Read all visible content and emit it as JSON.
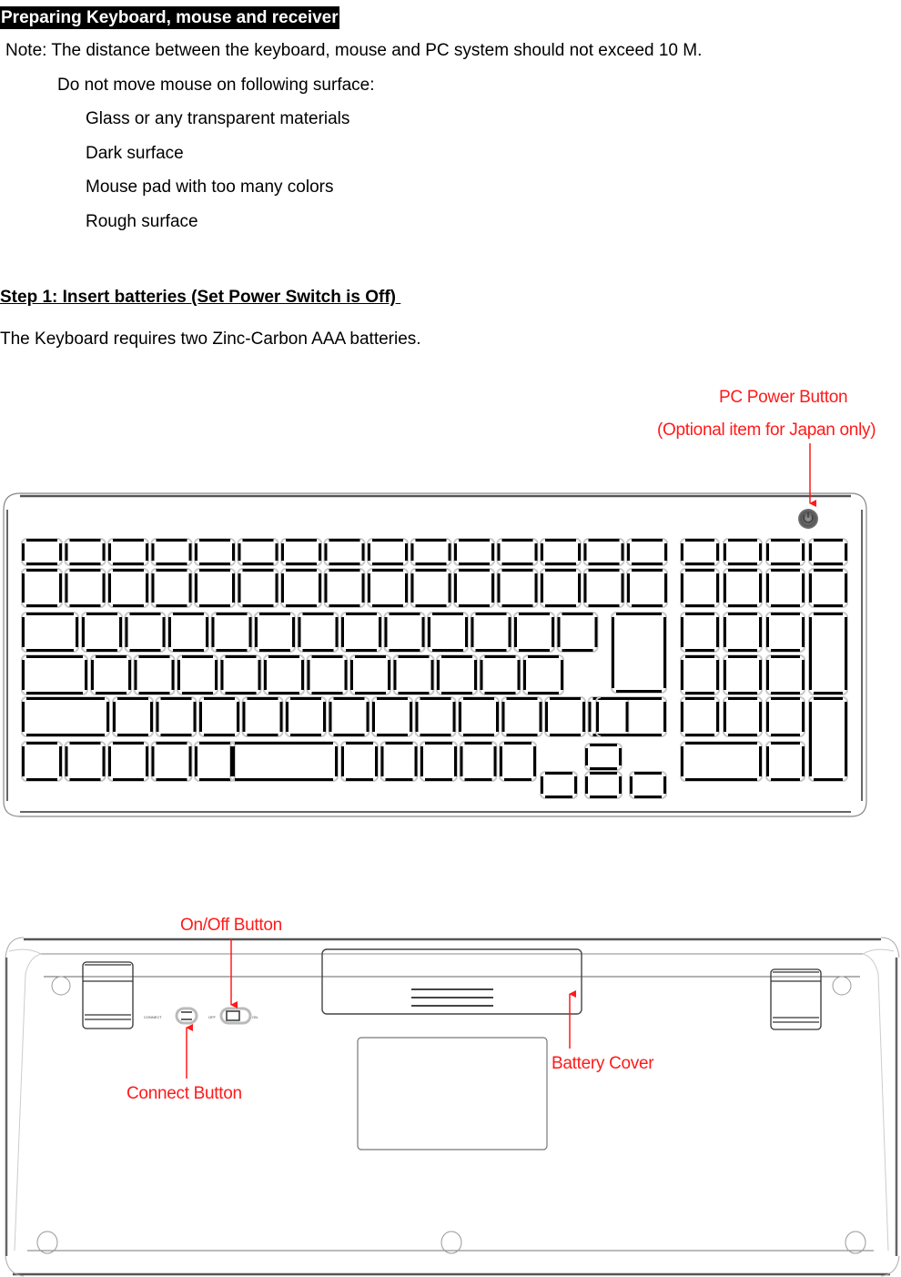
{
  "section": {
    "title": "Preparing Keyboard, mouse and receiver"
  },
  "note": {
    "line1": "Note: The distance between the keyboard, mouse and PC system should not exceed 10 M.",
    "line2": "Do not move mouse on following surface:",
    "surfaces": [
      "Glass or any transparent materials",
      "Dark surface",
      "Mouse pad with too many colors",
      "Rough surface"
    ]
  },
  "step1": {
    "title": "Step 1: Insert batteries (Set Power Switch is Off) ",
    "body": "The Keyboard requires two Zinc-Carbon AAA batteries."
  },
  "diagram_top": {
    "callouts": {
      "pc_power_button": "PC Power Button",
      "pc_power_note": "(Optional item for Japan only)"
    }
  },
  "diagram_bottom": {
    "callouts": {
      "on_off_button": "On/Off Button",
      "connect_button": "Connect Button",
      "battery_cover": "Battery Cover"
    },
    "switch_labels": {
      "connect": "CONNECT",
      "off": "OFF",
      "on": "ON"
    }
  },
  "colors": {
    "callout": "#ff1a1a",
    "heading_bg": "#000000",
    "heading_fg": "#ffffff"
  }
}
